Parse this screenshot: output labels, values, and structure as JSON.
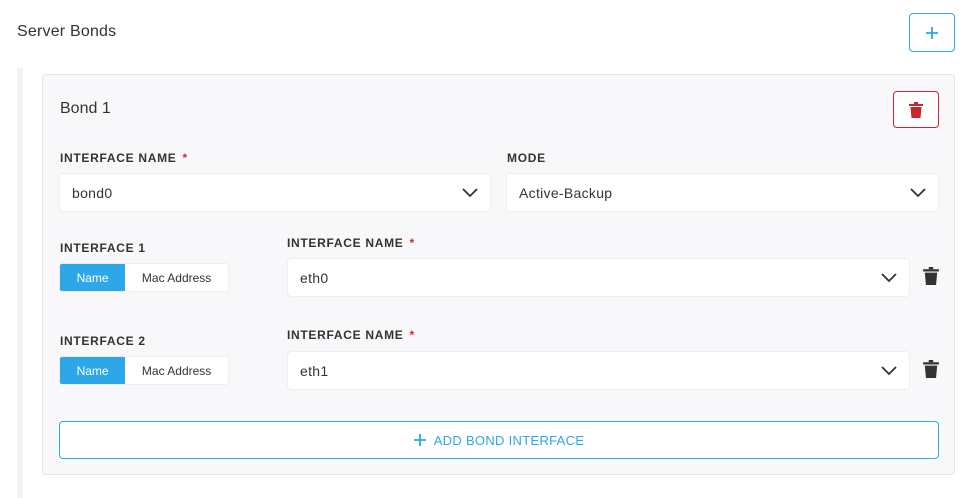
{
  "section": {
    "title": "Server Bonds",
    "add_icon": "plus-icon"
  },
  "bond": {
    "title": "Bond 1",
    "delete_icon": "trash-icon",
    "interface_name": {
      "label": "INTERFACE NAME",
      "required_mark": "*",
      "value": "bond0"
    },
    "mode": {
      "label": "MODE",
      "value": "Active-Backup"
    },
    "interfaces": [
      {
        "label": "INTERFACE 1",
        "toggle": [
          "Name",
          "Mac Address"
        ],
        "selected": "Name",
        "name_label": "INTERFACE NAME",
        "required_mark": "*",
        "value": "eth0"
      },
      {
        "label": "INTERFACE 2",
        "toggle": [
          "Name",
          "Mac Address"
        ],
        "selected": "Name",
        "name_label": "INTERFACE NAME",
        "required_mark": "*",
        "value": "eth1"
      }
    ],
    "add_interface_label": "ADD BOND INTERFACE"
  },
  "colors": {
    "accent": "#2ea7e8",
    "danger": "#c9252d",
    "required": "#d4292f"
  }
}
